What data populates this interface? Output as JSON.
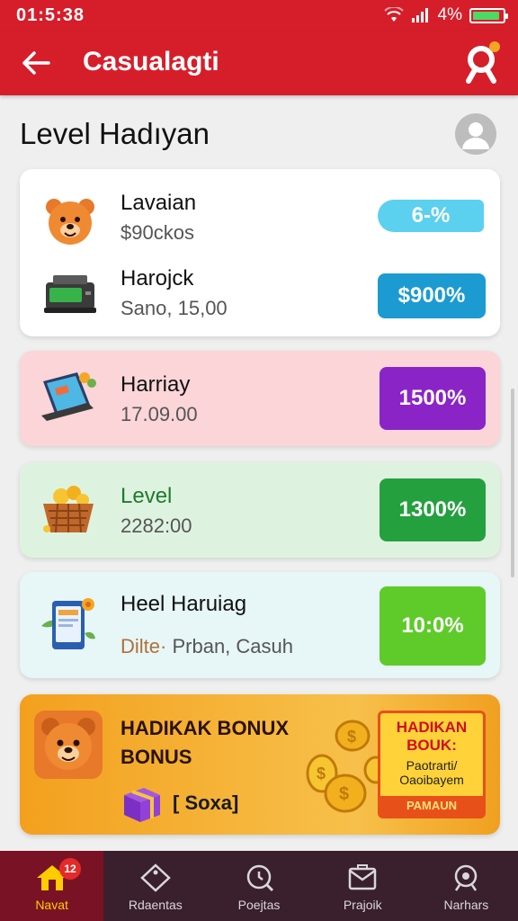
{
  "status": {
    "time": "01:5:38",
    "battery_pct": "4%"
  },
  "app_bar": {
    "title": "Casualagti"
  },
  "section": {
    "title": "Level Hadıyan"
  },
  "cards": [
    {
      "name": "Lavaian",
      "sub": "$90ckos",
      "percent": "6-%",
      "color": "#5bd0ef"
    },
    {
      "name": "Harojck",
      "sub": "Sano, 15,00",
      "percent": "$900%",
      "color": "#1b9bd1"
    },
    {
      "name": "Harriay",
      "sub": "17.09.00",
      "percent": "1500%",
      "color": "#8b24c7"
    },
    {
      "name": "Level",
      "sub": "2282:00",
      "percent": "1300%",
      "color": "#24a03f"
    },
    {
      "name": "Heel Haruiag",
      "sub_prefix": "Dilte·",
      "sub": "Prban, Casuh",
      "percent": "10:0%",
      "color": "#5ecb2b"
    }
  ],
  "promo": {
    "title": "HADIKAK BONUX BONUS",
    "tag": "[ Soxa]",
    "badge_title": "HADIKAN BOUK:",
    "badge_text": "Paotrarti/ Oaoibayem",
    "badge_foot": "PAMAUN"
  },
  "nav": {
    "items": [
      {
        "label": "Navat",
        "badge": "12"
      },
      {
        "label": "Rdaentas"
      },
      {
        "label": "Poejtas"
      },
      {
        "label": "Prajoik"
      },
      {
        "label": "Narhars"
      }
    ]
  },
  "colors": {
    "accent": "#d61e2a",
    "nav_bg": "#3a1f2c",
    "nav_active": "#7a1225"
  }
}
